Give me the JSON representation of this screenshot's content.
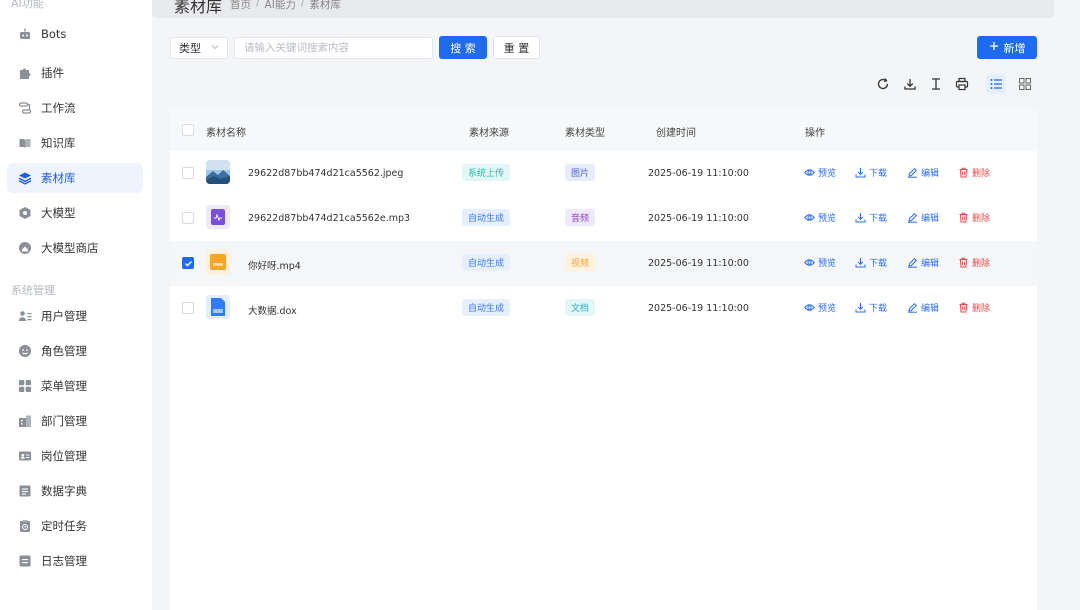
{
  "sidebar": {
    "group_ai": "AI功能",
    "group_system": "系统管理",
    "items": [
      {
        "label": "Bots",
        "icon": "robot-icon"
      },
      {
        "label": "插件",
        "icon": "puzzle-icon"
      },
      {
        "label": "工作流",
        "icon": "workflow-icon"
      },
      {
        "label": "知识库",
        "icon": "book-icon"
      },
      {
        "label": "素材库",
        "icon": "layers-icon",
        "active": true
      },
      {
        "label": "大模型",
        "icon": "model-icon"
      },
      {
        "label": "大模型商店",
        "icon": "store-icon"
      },
      {
        "label": "用户管理",
        "icon": "user-list-icon"
      },
      {
        "label": "角色管理",
        "icon": "role-icon"
      },
      {
        "label": "菜单管理",
        "icon": "grid-menu-icon"
      },
      {
        "label": "部门管理",
        "icon": "building-icon"
      },
      {
        "label": "岗位管理",
        "icon": "id-card-icon"
      },
      {
        "label": "数据字典",
        "icon": "dictionary-icon"
      },
      {
        "label": "定时任务",
        "icon": "clock-task-icon"
      },
      {
        "label": "日志管理",
        "icon": "log-icon"
      }
    ]
  },
  "header": {
    "title": "素材库",
    "crumbs": [
      "首页",
      "AI能力",
      "素材库"
    ]
  },
  "filter": {
    "type_label": "类型",
    "search_placeholder": "请输入关键词搜索内容",
    "search_button": "搜 索",
    "reset_button": "重 置",
    "add_button": "新增"
  },
  "table": {
    "columns": [
      "素材名称",
      "素材来源",
      "素材类型",
      "创建时间",
      "操作"
    ],
    "actions": {
      "preview": "预览",
      "download": "下载",
      "edit": "编辑",
      "delete": "删除"
    },
    "rows": [
      {
        "name": "29622d87bb474d21ca5562.jpeg",
        "source": "系统上传",
        "type": "图片",
        "time": "2025-06-19 11:10:00",
        "checked": false,
        "thumb": "image"
      },
      {
        "name": "29622d87bb474d21ca5562e.mp3",
        "source": "自动生成",
        "type": "音频",
        "time": "2025-06-19 11:10:00",
        "checked": false,
        "thumb": "audio"
      },
      {
        "name": "你好呀.mp4",
        "source": "自动生成",
        "type": "视频",
        "time": "2025-06-19 11:10:00",
        "checked": true,
        "thumb": "video"
      },
      {
        "name": "大数据.dox",
        "source": "自动生成",
        "type": "文档",
        "time": "2025-06-19 11:10:00",
        "checked": false,
        "thumb": "doc"
      }
    ]
  },
  "colors": {
    "primary": "#1f6bf0",
    "danger": "#e84a4a",
    "active_nav_bg": "#eef3fd"
  }
}
